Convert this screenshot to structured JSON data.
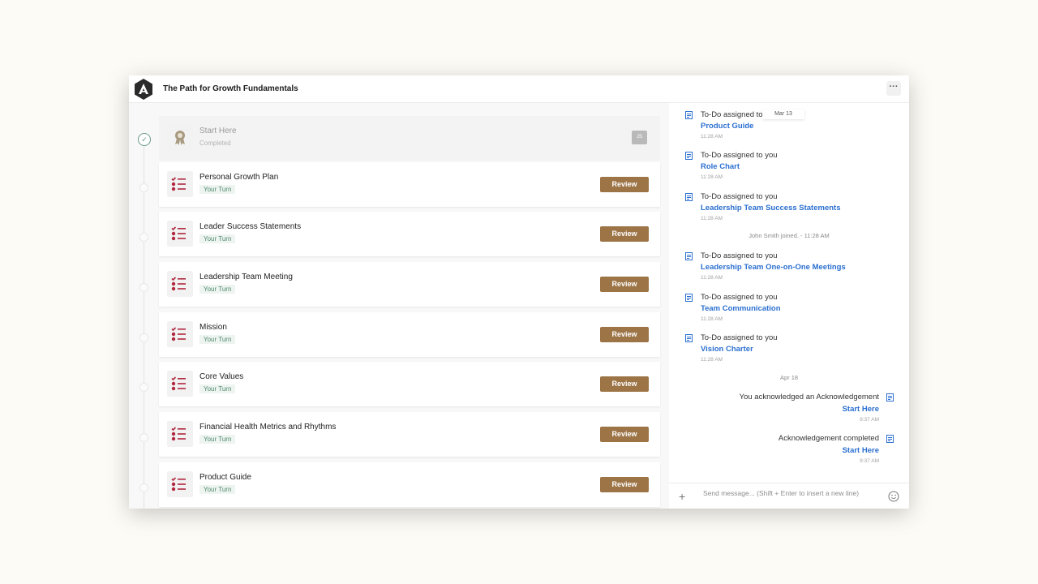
{
  "app": {
    "title": "The Path for Growth Fundamentals",
    "more_label": "···"
  },
  "journey": {
    "first": {
      "title": "Start Here",
      "status": "Completed",
      "initials": "JS"
    },
    "items": [
      {
        "title": "Personal Growth Plan",
        "badge": "Your Turn",
        "action": "Review"
      },
      {
        "title": "Leader Success Statements",
        "badge": "Your Turn",
        "action": "Review"
      },
      {
        "title": "Leadership Team Meeting",
        "badge": "Your Turn",
        "action": "Review"
      },
      {
        "title": "Mission",
        "badge": "Your Turn",
        "action": "Review"
      },
      {
        "title": "Core Values",
        "badge": "Your Turn",
        "action": "Review"
      },
      {
        "title": "Financial Health Metrics and Rhythms",
        "badge": "Your Turn",
        "action": "Review"
      },
      {
        "title": "Product Guide",
        "badge": "Your Turn",
        "action": "Review"
      }
    ]
  },
  "feed": {
    "date_chip_1": "Mar 13",
    "activities": [
      {
        "text": "To-Do assigned to",
        "link": "Product Guide",
        "time": "11:28 AM"
      },
      {
        "text": "To-Do assigned to you",
        "link": "Role Chart",
        "time": "11:28 AM"
      },
      {
        "text": "To-Do assigned to you",
        "link": "Leadership Team Success Statements",
        "time": "11:28 AM"
      },
      {
        "text": "To-Do assigned to you",
        "link": "Leadership Team One-on-One Meetings",
        "time": "11:28 AM"
      },
      {
        "text": "To-Do assigned to you",
        "link": "Team Communication",
        "time": "11:28 AM"
      },
      {
        "text": "To-Do assigned to you",
        "link": "Vision Charter",
        "time": "11:28 AM"
      }
    ],
    "joined_msg": "John Smith joined. - 11:28 AM",
    "date_chip_2": "Apr 18",
    "own_activities": [
      {
        "text": "You acknowledged an Acknowledgement",
        "link": "Start Here",
        "time": "9:37 AM"
      },
      {
        "text": "Acknowledgement completed",
        "link": "Start Here",
        "time": "9:37 AM"
      }
    ]
  },
  "composer": {
    "placeholder": "Send message... (Shift + Enter to insert a new line)",
    "plus_label": "+"
  },
  "colors": {
    "accent": "#9c7446",
    "link": "#2b6fd0",
    "badge_text": "#4f8a6e",
    "icon_red": "#b0283f"
  }
}
